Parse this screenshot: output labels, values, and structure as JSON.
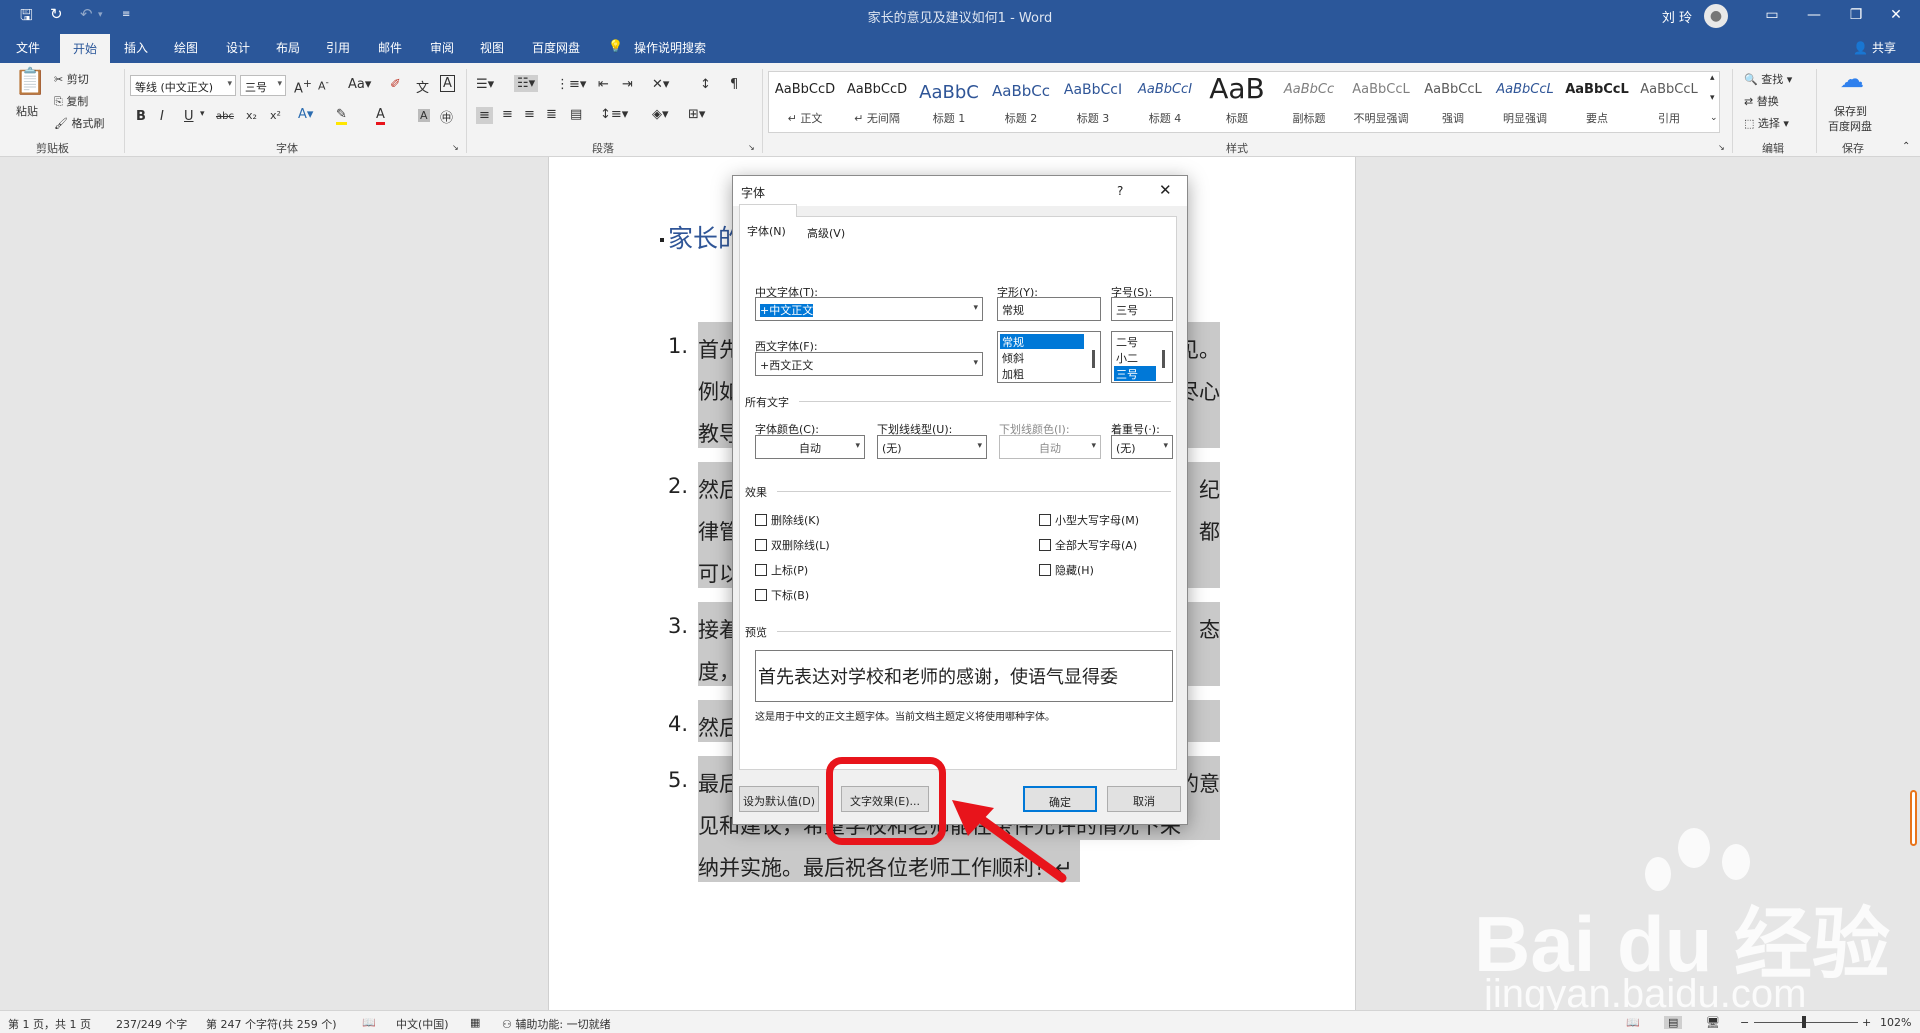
{
  "window": {
    "title": "家长的意见及建议如何1 - Word",
    "user": "刘 玲"
  },
  "ribbon_tabs": [
    "文件",
    "开始",
    "插入",
    "绘图",
    "设计",
    "布局",
    "引用",
    "邮件",
    "审阅",
    "视图",
    "百度网盘"
  ],
  "tell_me": "操作说明搜索",
  "share": "共享",
  "clipboard": {
    "paste": "粘贴",
    "cut": "剪切",
    "copy": "复制",
    "format_painter": "格式刷",
    "label": "剪贴板"
  },
  "font_group": {
    "font_name": "等线 (中文正文)",
    "font_size": "三号",
    "label": "字体"
  },
  "paragraph_group": {
    "label": "段落"
  },
  "styles_group": {
    "label": "样式",
    "items": [
      {
        "sample": "AaBbCcD",
        "name": "↵ 正文"
      },
      {
        "sample": "AaBbCcD",
        "name": "↵ 无间隔"
      },
      {
        "sample": "AaBbC",
        "name": "标题 1"
      },
      {
        "sample": "AaBbCc",
        "name": "标题 2"
      },
      {
        "sample": "AaBbCcI",
        "name": "标题 3"
      },
      {
        "sample": "AaBbCcI",
        "name": "标题 4"
      },
      {
        "sample": "AaB",
        "name": "标题"
      },
      {
        "sample": "AaBbCc",
        "name": "副标题"
      },
      {
        "sample": "AaBbCcL",
        "name": "不明显强调"
      },
      {
        "sample": "AaBbCcL",
        "name": "强调"
      },
      {
        "sample": "AaBbCcL",
        "name": "明显强调"
      },
      {
        "sample": "AaBbCcL",
        "name": "要点"
      },
      {
        "sample": "AaBbCcL",
        "name": "引用"
      }
    ]
  },
  "editing_group": {
    "find": "查找",
    "replace": "替换",
    "select": "选择",
    "label": "编辑"
  },
  "save_group": {
    "save_line1": "保存到",
    "save_line2": "百度网盘",
    "label": "保存"
  },
  "document": {
    "heading": "家长的",
    "items": [
      {
        "num": "1.",
        "lines": [
          "首先",
          "例如",
          "教导"
        ],
        "right": [
          "见。",
          "尽心",
          ""
        ]
      },
      {
        "num": "2.",
        "lines": [
          "然后",
          "律管",
          "可以"
        ],
        "right": [
          "纪",
          "都",
          ""
        ]
      },
      {
        "num": "3.",
        "lines": [
          "接着",
          "度，"
        ],
        "right": [
          "态",
          ""
        ]
      },
      {
        "num": "4.",
        "lines": [
          "然后"
        ],
        "right": [
          ""
        ]
      },
      {
        "num": "5.",
        "lines": [
          "最后",
          "见和建议，希望学校和老师能在条件允许的情况下采",
          "纳并实施。最后祝各位老师工作顺利！↵"
        ],
        "right": [
          "的意",
          "",
          ""
        ]
      }
    ]
  },
  "dialog": {
    "title": "字体",
    "help": "?",
    "tabs": [
      "字体(N)",
      "高级(V)"
    ],
    "chinese_font_label": "中文字体(T):",
    "chinese_font_value": "+中文正文",
    "western_font_label": "西文字体(F):",
    "western_font_value": "+西文正文",
    "style_label": "字形(Y):",
    "style_value": "常规",
    "style_options": [
      "常规",
      "倾斜",
      "加粗"
    ],
    "size_label": "字号(S):",
    "size_value": "三号",
    "size_options": [
      "二号",
      "小二",
      "三号"
    ],
    "all_text": "所有文字",
    "font_color_label": "字体颜色(C):",
    "font_color_value": "自动",
    "underline_style_label": "下划线线型(U):",
    "underline_style_value": "(无)",
    "underline_color_label": "下划线颜色(I):",
    "underline_color_value": "自动",
    "emphasis_label": "着重号(·):",
    "emphasis_value": "(无)",
    "effects": "效果",
    "effects_left": [
      "删除线(K)",
      "双删除线(L)",
      "上标(P)",
      "下标(B)"
    ],
    "effects_right": [
      "小型大写字母(M)",
      "全部大写字母(A)",
      "隐藏(H)"
    ],
    "preview": "预览",
    "preview_text": "首先表达对学校和老师的感谢，使语气显得委",
    "preview_note": "这是用于中文的正文主题字体。当前文档主题定义将使用哪种字体。",
    "set_default": "设为默认值(D)",
    "text_effects": "文字效果(E)...",
    "ok": "确定",
    "cancel": "取消"
  },
  "statusbar": {
    "page": "第 1 页，共 1 页",
    "words": "237/249 个字",
    "chars": "第 247 个字符(共 259 个)",
    "lang": "中文(中国)",
    "accessibility": "辅助功能: 一切就绪",
    "zoom": "102%"
  },
  "watermark": {
    "brand": "Bai du 经验",
    "url": "jingyan.baidu.com"
  },
  "colors": {
    "accent": "#2b579a",
    "highlight_red": "#e8141b",
    "selection": "#0078d7"
  }
}
